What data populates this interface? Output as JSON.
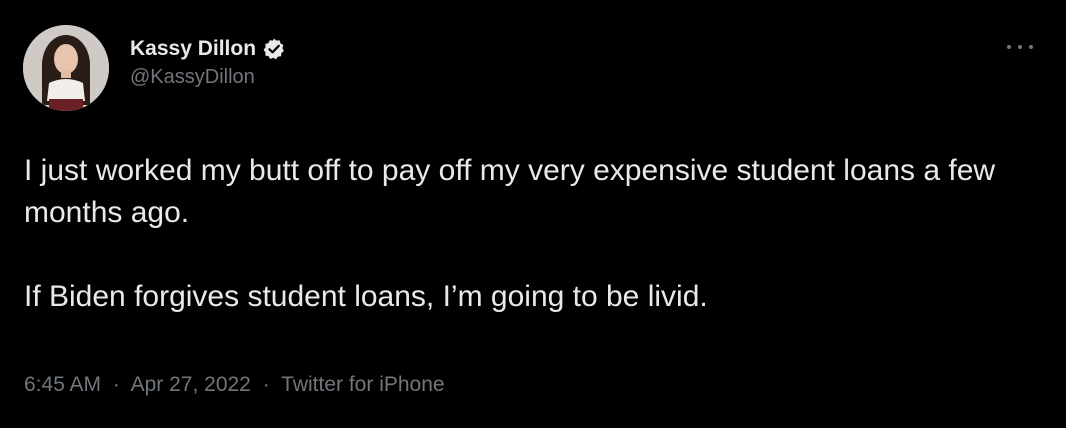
{
  "author": {
    "display_name": "Kassy Dillon",
    "handle": "@KassyDillon",
    "verified": true
  },
  "tweet": {
    "paragraphs": [
      "I just worked my butt off to pay off my very expensive student loans a few months ago.",
      "If Biden forgives student loans, I’m going to be livid."
    ],
    "time": "6:45 AM",
    "separator": "·",
    "date": "Apr 27, 2022",
    "source": "Twitter for iPhone"
  },
  "icons": {
    "verified": "verified-badge-icon",
    "more": "more-options-icon"
  },
  "colors": {
    "background": "#000000",
    "primary_text": "#e7e9ea",
    "secondary_text": "#71767b"
  }
}
